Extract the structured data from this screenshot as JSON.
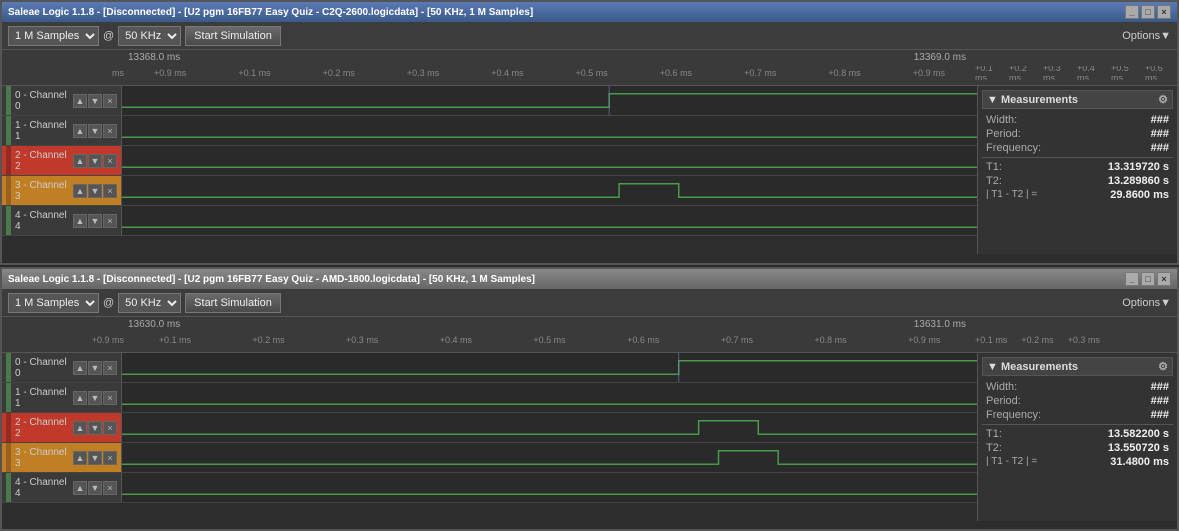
{
  "windows": [
    {
      "id": "window1",
      "title": "Saleae Logic 1.1.8 - [Disconnected] - [U2 pgm 16FB77 Easy Quiz - C2Q-2600.logicdata] - [50 KHz, 1 M Samples]",
      "active": true,
      "toolbar": {
        "samples": "1 M Samples",
        "at_label": "@",
        "frequency": "50 KHz",
        "start_btn": "Start Simulation",
        "options_btn": "Options▼"
      },
      "timeline": {
        "left_time": "13368.0 ms",
        "right_time": "13369.0 ms",
        "ticks_left": [
          "ms",
          "+0.9 ms",
          "+0.1 ms",
          "+0.2 ms",
          "+0.3 ms",
          "+0.4 ms",
          "+0.5 ms",
          "+0.6 ms",
          "+0.7 ms",
          "+0.8 ms",
          "+0.9 ms"
        ],
        "ticks_right": [
          "+0.1 ms",
          "+0.2 ms",
          "+0.3 ms",
          "+0.4 ms",
          "+0.5 ms",
          "+0.6 ms"
        ]
      },
      "channels": [
        {
          "id": 0,
          "name": "0 - Channel 0",
          "color": "default",
          "signal": "low_with_rise"
        },
        {
          "id": 1,
          "name": "1 - Channel 1",
          "color": "default",
          "signal": "low"
        },
        {
          "id": 2,
          "name": "2 - Channel 2",
          "color": "red",
          "signal": "low"
        },
        {
          "id": 3,
          "name": "3 - Channel 3",
          "color": "orange",
          "signal": "pulse_mid"
        },
        {
          "id": 4,
          "name": "4 - Channel 4",
          "color": "default",
          "signal": "low"
        }
      ],
      "measurements": {
        "title": "▼ Measurements",
        "width_label": "Width:",
        "width_value": "###",
        "period_label": "Period:",
        "period_value": "###",
        "frequency_label": "Frequency:",
        "frequency_value": "###",
        "t1_label": "T1:",
        "t1_value": "13.319720 s",
        "t2_label": "T2:",
        "t2_value": "13.289860 s",
        "diff_label": "| T1 - T2 | =",
        "diff_value": "29.8600 ms"
      }
    },
    {
      "id": "window2",
      "title": "Saleae Logic 1.1.8 - [Disconnected] - [U2 pgm 16FB77 Easy Quiz - AMD-1800.logicdata] - [50 KHz, 1 M Samples]",
      "active": false,
      "toolbar": {
        "samples": "1 M Samples",
        "at_label": "@",
        "frequency": "50 KHz",
        "start_btn": "Start Simulation",
        "options_btn": "Options▼"
      },
      "timeline": {
        "left_time": "13630.0 ms",
        "right_time": "13631.0 ms",
        "ticks_left": [
          "+0.9 ms",
          "+0.1 ms",
          "+0.2 ms",
          "+0.3 ms",
          "+0.4 ms",
          "+0.5 ms",
          "+0.6 ms",
          "+0.7 ms",
          "+0.8 ms",
          "+0.9 ms"
        ],
        "ticks_right": [
          "+0.1 ms",
          "+0.2 ms",
          "+0.3 ms"
        ]
      },
      "channels": [
        {
          "id": 0,
          "name": "0 - Channel 0",
          "color": "default",
          "signal": "low_with_rise2"
        },
        {
          "id": 1,
          "name": "1 - Channel 1",
          "color": "default",
          "signal": "low"
        },
        {
          "id": 2,
          "name": "2 - Channel 2",
          "color": "red",
          "signal": "pulse_right"
        },
        {
          "id": 3,
          "name": "3 - Channel 3",
          "color": "orange",
          "signal": "pulse_right2"
        },
        {
          "id": 4,
          "name": "4 - Channel 4",
          "color": "default",
          "signal": "low"
        }
      ],
      "measurements": {
        "title": "▼ Measurements",
        "width_label": "Width:",
        "width_value": "###",
        "period_label": "Period:",
        "period_value": "###",
        "frequency_label": "Frequency:",
        "frequency_value": "###",
        "t1_label": "T1:",
        "t1_value": "13.582200 s",
        "t2_label": "T2:",
        "t2_value": "13.550720 s",
        "diff_label": "| T1 - T2 | =",
        "diff_value": "31.4800 ms"
      }
    }
  ]
}
